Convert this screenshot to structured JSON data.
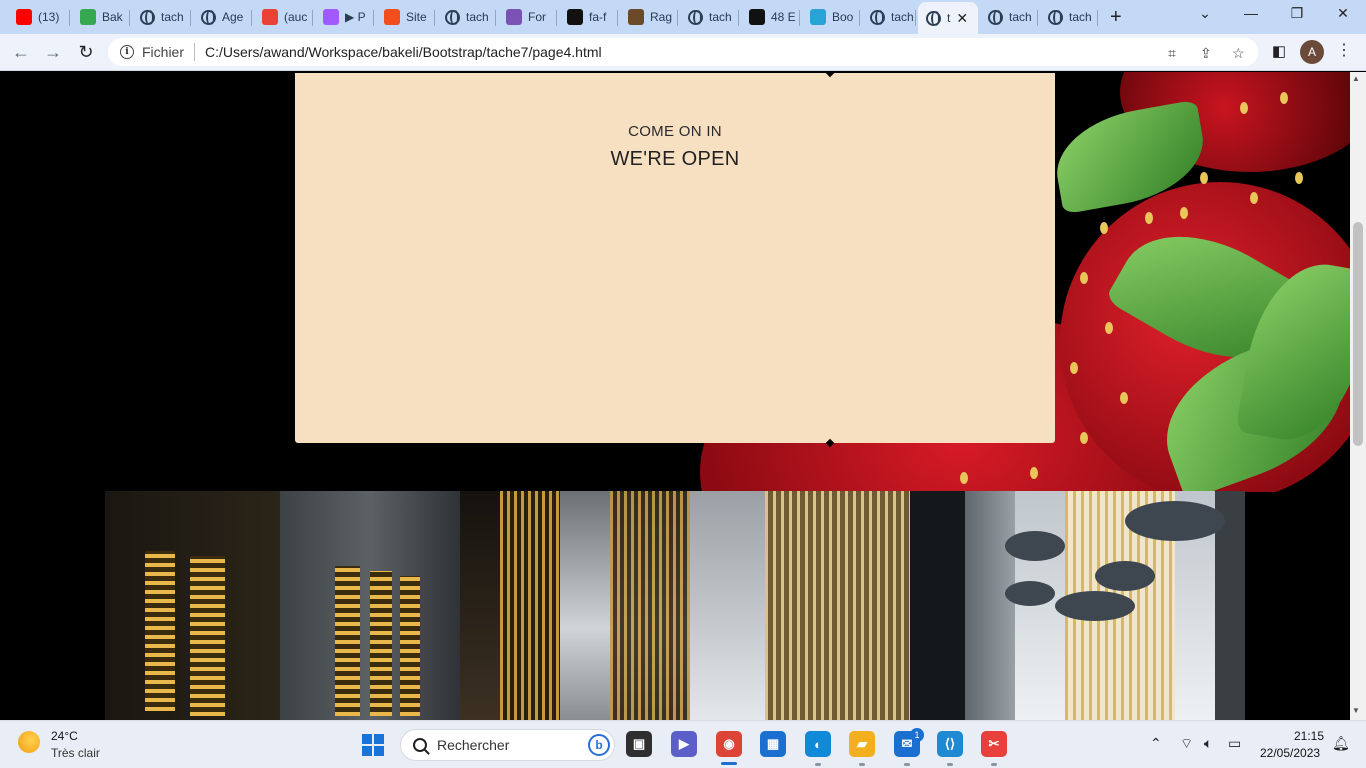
{
  "browser": {
    "tabs": [
      {
        "label": "(13)",
        "icon": "youtube-icon",
        "color": "#ff0000"
      },
      {
        "label": "Bak",
        "icon": "bakeli-icon",
        "color": "#36a852"
      },
      {
        "label": "tach",
        "icon": "globe-icon"
      },
      {
        "label": "Age",
        "icon": "web-icon"
      },
      {
        "label": "(auc",
        "icon": "gmail-icon",
        "color": "#ea4335"
      },
      {
        "label": "▶ P",
        "icon": "figma-icon",
        "color": "#a259ff"
      },
      {
        "label": "Site",
        "icon": "figma-icon",
        "color": "#f24e1e"
      },
      {
        "label": "tach",
        "icon": "globe-icon"
      },
      {
        "label": "For",
        "icon": "bootstrap-icon",
        "color": "#7952b3"
      },
      {
        "label": "fa-f",
        "icon": "flag-icon",
        "color": "#111111"
      },
      {
        "label": "Rag",
        "icon": "image-icon",
        "color": "#6b4a2a"
      },
      {
        "label": "tach",
        "icon": "globe-icon"
      },
      {
        "label": "48 E",
        "icon": "fontawesome-icon",
        "color": "#111111"
      },
      {
        "label": "Boo",
        "icon": "bootdey-icon",
        "color": "#27a3d8"
      },
      {
        "label": "tach",
        "icon": "globe-icon"
      },
      {
        "label": "t",
        "icon": "globe-icon",
        "active": true
      },
      {
        "label": "tach",
        "icon": "globe-icon"
      },
      {
        "label": "tach",
        "icon": "globe-icon"
      }
    ],
    "new_tab": "+",
    "url_scheme": "Fichier",
    "url": "C:/Users/awand/Workspace/bakeli/Bootstrap/tache7/page4.html",
    "profile_initial": "A"
  },
  "page": {
    "kicker": "COME ON IN",
    "title": "WE'RE OPEN"
  },
  "taskbar": {
    "weather_temp": "24°C",
    "weather_desc": "Très clair",
    "search_placeholder": "Rechercher",
    "apps": [
      {
        "name": "task-view",
        "color": "#2f2f2f"
      },
      {
        "name": "teams",
        "color": "#5b5fc7"
      },
      {
        "name": "chrome",
        "color": "#db4437"
      },
      {
        "name": "store",
        "color": "#1a6fd0"
      },
      {
        "name": "edge",
        "color": "#0f8ad8"
      },
      {
        "name": "file-explorer",
        "color": "#f2b01e"
      },
      {
        "name": "mail",
        "color": "#1a6fd0"
      },
      {
        "name": "vscode",
        "color": "#1f8ad2"
      },
      {
        "name": "snipping-tool",
        "color": "#e8403a"
      }
    ],
    "mail_badge": "1",
    "time": "21:15",
    "date": "22/05/2023"
  }
}
